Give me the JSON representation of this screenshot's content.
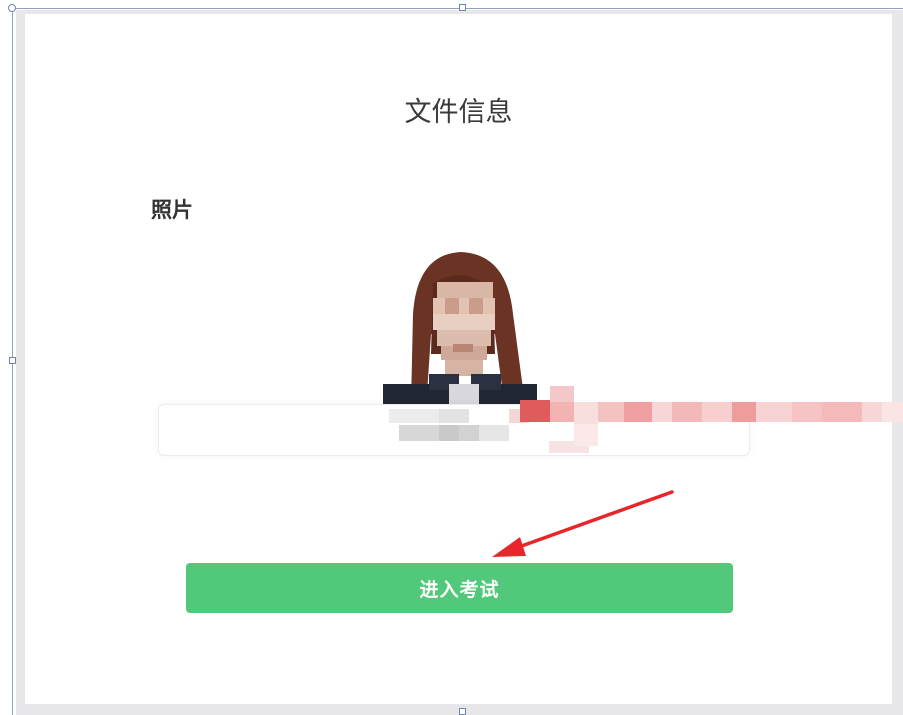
{
  "card": {
    "title": "文件信息",
    "photo_label": "照片"
  },
  "actions": {
    "enter_exam_label": "进入考试"
  },
  "annotation": {
    "arrow_color": "#e8262a"
  },
  "colors": {
    "button_bg": "#52c97a",
    "backdrop": "#e7e7ea"
  }
}
